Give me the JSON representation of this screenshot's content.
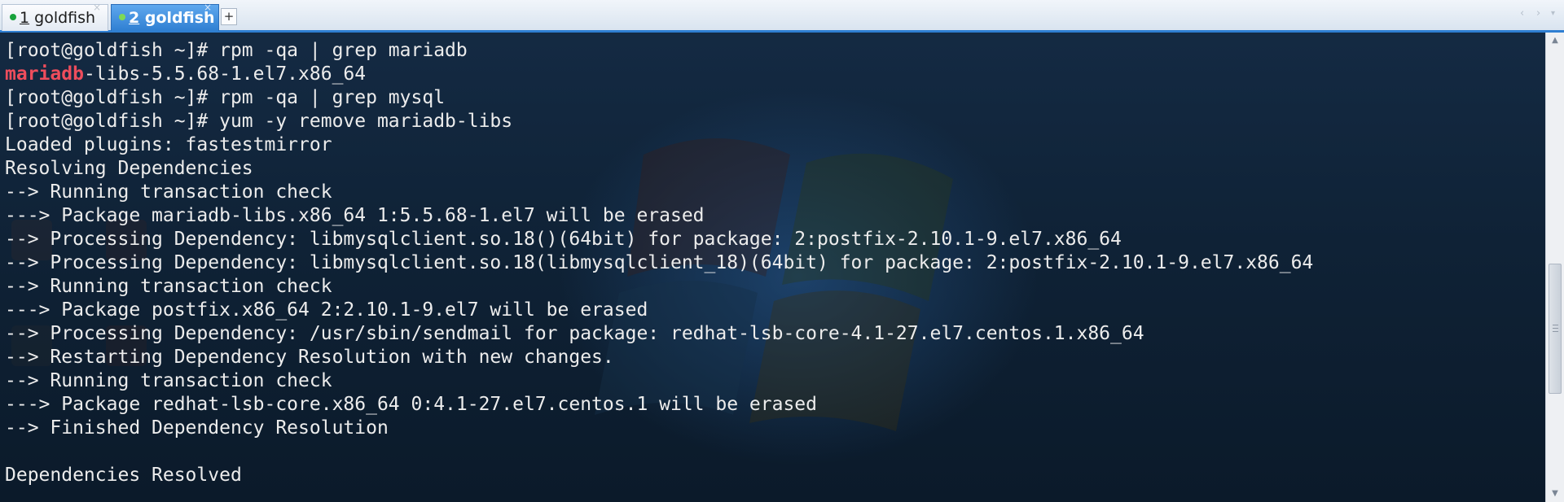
{
  "tabs": [
    {
      "number": "1",
      "name": " goldfish",
      "status_color": "#18a23c",
      "active": false
    },
    {
      "number": "2",
      "name": " goldfish",
      "status_color": "#7ed957",
      "active": true
    }
  ],
  "tab_close_glyph": "×",
  "new_tab_glyph": "+",
  "nav_left_glyph": "‹",
  "nav_right_glyph": "›",
  "nav_menu_glyph": "▾",
  "colors": {
    "tab_accent": "#2f7fd2",
    "terminal_bg": "#0f2236",
    "terminal_text": "#ececec",
    "grep_highlight": "#ee4d5c"
  },
  "terminal": {
    "lines": [
      {
        "text": "[root@goldfish ~]# rpm -qa | grep mariadb"
      },
      {
        "highlight": "mariadb",
        "text": "-libs-5.5.68-1.el7.x86_64"
      },
      {
        "text": "[root@goldfish ~]# rpm -qa | grep mysql"
      },
      {
        "text": "[root@goldfish ~]# yum -y remove mariadb-libs"
      },
      {
        "text": "Loaded plugins: fastestmirror"
      },
      {
        "text": "Resolving Dependencies"
      },
      {
        "text": "--> Running transaction check"
      },
      {
        "text": "---> Package mariadb-libs.x86_64 1:5.5.68-1.el7 will be erased"
      },
      {
        "text": "--> Processing Dependency: libmysqlclient.so.18()(64bit) for package: 2:postfix-2.10.1-9.el7.x86_64"
      },
      {
        "text": "--> Processing Dependency: libmysqlclient.so.18(libmysqlclient_18)(64bit) for package: 2:postfix-2.10.1-9.el7.x86_64"
      },
      {
        "text": "--> Running transaction check"
      },
      {
        "text": "---> Package postfix.x86_64 2:2.10.1-9.el7 will be erased"
      },
      {
        "text": "--> Processing Dependency: /usr/sbin/sendmail for package: redhat-lsb-core-4.1-27.el7.centos.1.x86_64"
      },
      {
        "text": "--> Restarting Dependency Resolution with new changes."
      },
      {
        "text": "--> Running transaction check"
      },
      {
        "text": "---> Package redhat-lsb-core.x86_64 0:4.1-27.el7.centos.1 will be erased"
      },
      {
        "text": "--> Finished Dependency Resolution"
      },
      {
        "text": ""
      },
      {
        "text": "Dependencies Resolved"
      }
    ]
  },
  "scrollbar": {
    "up_glyph": "▲",
    "down_glyph": "▼",
    "position": 0.7
  }
}
